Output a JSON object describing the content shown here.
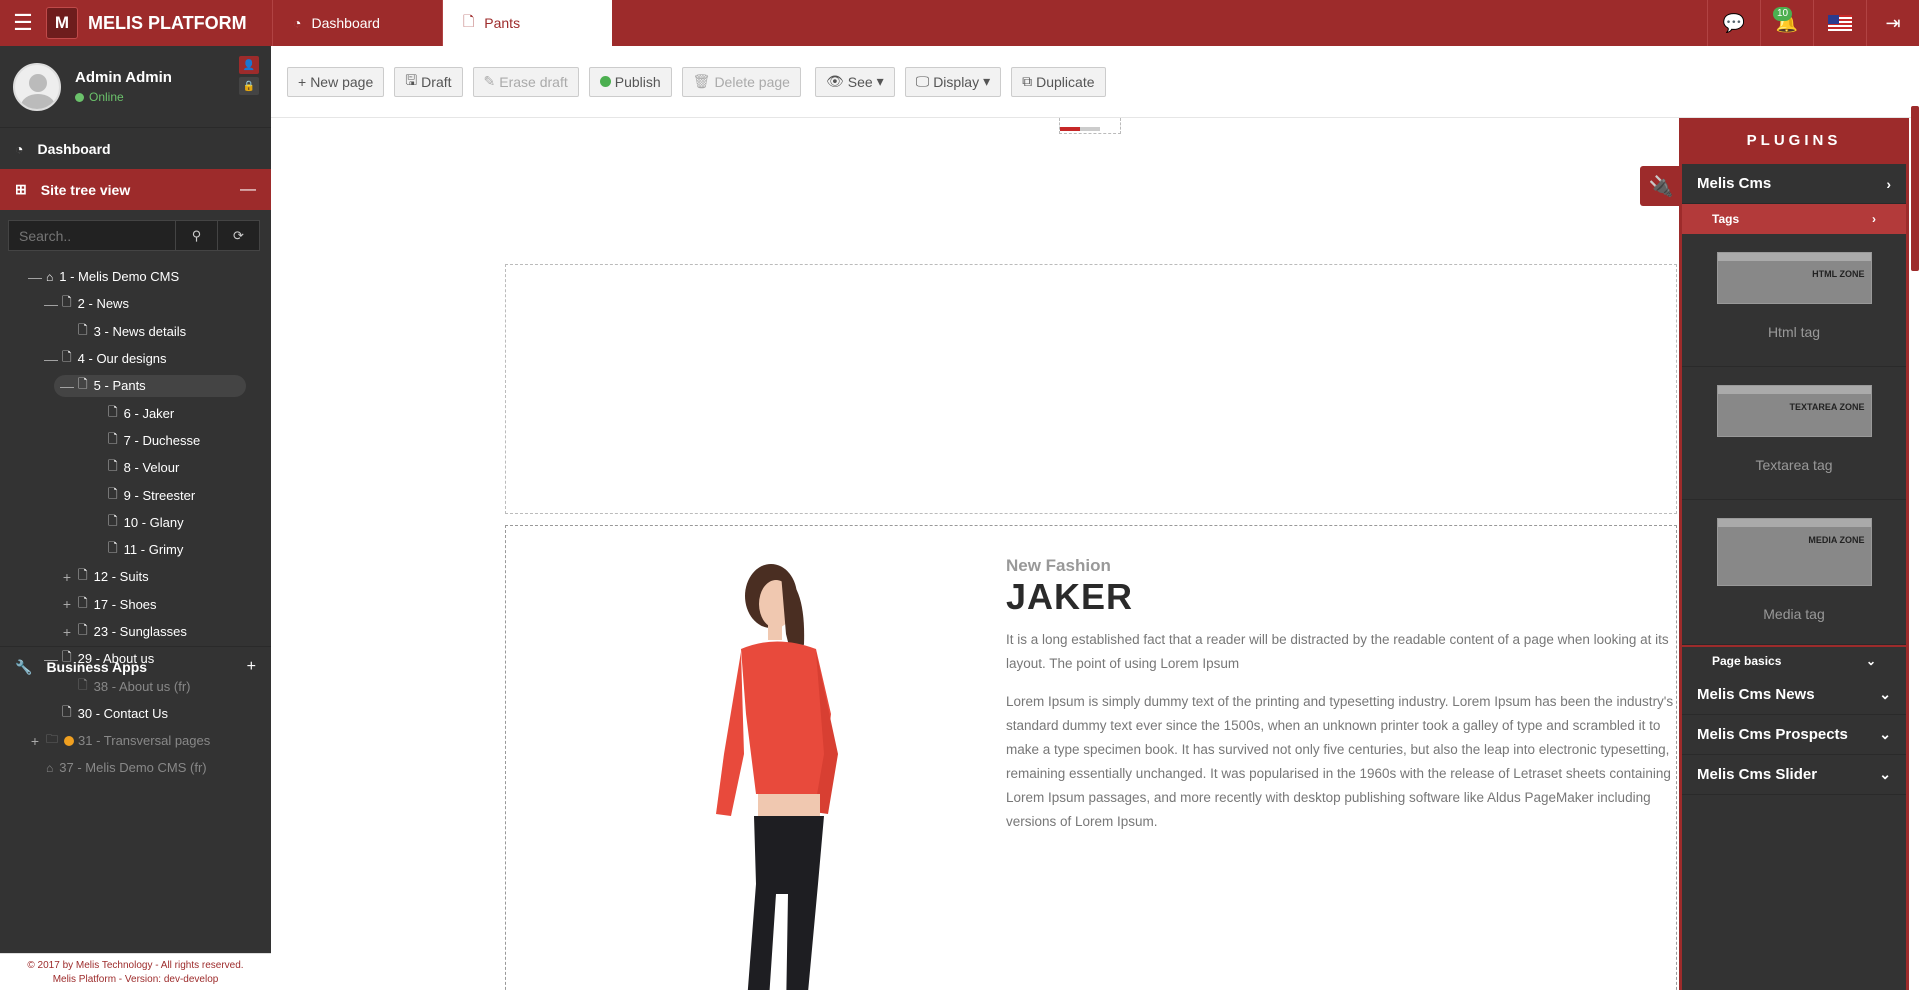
{
  "topbar": {
    "menu_icon": "hamburger-icon",
    "logo_letter": "M",
    "brand": "MELIS PLATFORM",
    "tabs": [
      {
        "label": "Dashboard",
        "icon": "dashboard-icon",
        "active": false
      },
      {
        "label": "Pants",
        "icon": "file-icon",
        "active": true
      }
    ],
    "notification_count": "10",
    "colors": {
      "primary": "#9d2b2b",
      "sidebar": "#333333",
      "online": "#6bc26b"
    }
  },
  "user": {
    "name": "Admin Admin",
    "status": "Online"
  },
  "sidebar": {
    "dashboard_label": "Dashboard",
    "site_tree_label": "Site tree view",
    "site_tree_toggle": "—",
    "search_placeholder": "Search..",
    "business_apps_label": "Business Apps",
    "business_apps_toggle": "+"
  },
  "tree": [
    {
      "label": "1 - Melis Demo CMS",
      "tog": "—",
      "icon": "⌂",
      "dim": false,
      "sel": false,
      "level": 1
    },
    {
      "label": "2 - News",
      "tog": "—",
      "icon": "🗋",
      "dim": false,
      "sel": false,
      "level": 2
    },
    {
      "label": "3 - News details",
      "tog": "",
      "icon": "🗋",
      "dim": false,
      "sel": false,
      "level": 3
    },
    {
      "label": "4 - Our designs",
      "tog": "—",
      "icon": "🗋",
      "dim": false,
      "sel": false,
      "level": 2
    },
    {
      "label": "5 - Pants",
      "tog": "—",
      "icon": "🗋",
      "dim": false,
      "sel": true,
      "level": 3
    },
    {
      "label": "6 - Jaker",
      "tog": "",
      "icon": "🗋",
      "dim": false,
      "sel": false,
      "level": 4
    },
    {
      "label": "7 - Duchesse",
      "tog": "",
      "icon": "🗋",
      "dim": false,
      "sel": false,
      "level": 4
    },
    {
      "label": "8 - Velour",
      "tog": "",
      "icon": "🗋",
      "dim": false,
      "sel": false,
      "level": 4
    },
    {
      "label": "9 - Streester",
      "tog": "",
      "icon": "🗋",
      "dim": false,
      "sel": false,
      "level": 4
    },
    {
      "label": "10 - Glany",
      "tog": "",
      "icon": "🗋",
      "dim": false,
      "sel": false,
      "level": 4
    },
    {
      "label": "11 - Grimy",
      "tog": "",
      "icon": "🗋",
      "dim": false,
      "sel": false,
      "level": 4
    },
    {
      "label": "12 - Suits",
      "tog": "+",
      "icon": "🗋",
      "dim": false,
      "sel": false,
      "level": 3
    },
    {
      "label": "17 - Shoes",
      "tog": "+",
      "icon": "🗋",
      "dim": false,
      "sel": false,
      "level": 3
    },
    {
      "label": "23 - Sunglasses",
      "tog": "+",
      "icon": "🗋",
      "dim": false,
      "sel": false,
      "level": 3
    },
    {
      "label": "29 - About us",
      "tog": "—",
      "icon": "🗋",
      "dim": false,
      "sel": false,
      "level": 2
    },
    {
      "label": "38 - About us (fr)",
      "tog": "",
      "icon": "🗋",
      "dim": true,
      "sel": false,
      "level": 3
    },
    {
      "label": "30 - Contact Us",
      "tog": "",
      "icon": "🗋",
      "dim": false,
      "sel": false,
      "level": 2
    },
    {
      "label": "31 - Transversal pages",
      "tog": "+",
      "icon": "🗀",
      "dim": true,
      "sel": false,
      "level": 1,
      "dot": true
    },
    {
      "label": "37 - Melis Demo CMS (fr)",
      "tog": "",
      "icon": "⌂",
      "dim": true,
      "sel": false,
      "level": 1
    }
  ],
  "footer": {
    "line1": "© 2017 by Melis Technology - All rights reserved.",
    "line2": "Melis Platform - Version: dev-develop"
  },
  "toolbar": {
    "new_page": "New page",
    "draft": "Draft",
    "erase_draft": "Erase draft",
    "publish": "Publish",
    "delete_page": "Delete page",
    "see": "See",
    "display": "Display",
    "duplicate": "Duplicate"
  },
  "page": {
    "subtitle": "New Fashion",
    "title": "JAKER",
    "para1": "It is a long established fact that a reader will be distracted by the readable content of a page when looking at its layout. The point of using Lorem Ipsum",
    "para2": "Lorem Ipsum is simply dummy text of the printing and typesetting industry. Lorem Ipsum has been the industry's standard dummy text ever since the 1500s, when an unknown printer took a galley of type and scrambled it to make a type specimen book. It has survived not only five centuries, but also the leap into electronic typesetting, remaining essentially unchanged. It was popularised in the 1960s with the release of Letraset sheets containing Lorem Ipsum passages, and more recently with desktop publishing software like Aldus PageMaker including versions of Lorem Ipsum."
  },
  "plugins": {
    "header": "PLUGINS",
    "melis_cms": "Melis Cms",
    "tags": "Tags",
    "tag_cards": [
      {
        "label": "Html tag",
        "thumb": "HTML ZONE"
      },
      {
        "label": "Textarea tag",
        "thumb": "TEXTAREA ZONE"
      },
      {
        "label": "Media tag",
        "thumb": "MEDIA ZONE"
      }
    ],
    "page_basics": "Page basics",
    "groups": [
      "Melis Cms News",
      "Melis Cms Prospects",
      "Melis Cms Slider"
    ]
  }
}
